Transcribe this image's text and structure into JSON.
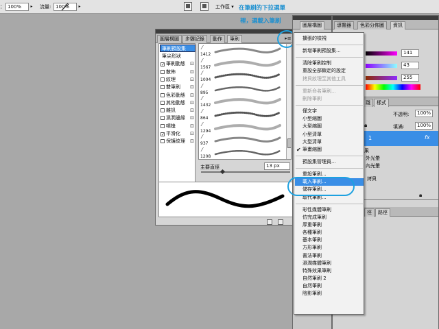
{
  "options_bar": {
    "opacity_label": "：",
    "opacity_value": "100%",
    "flow_label": "流量:",
    "flow_value": "100%",
    "workspace_label": "工作區 ▾"
  },
  "annotation": {
    "line1": "在筆刷的下拉選單",
    "line2": "裡，選載入筆刷"
  },
  "brush_panel": {
    "tabs": [
      "圖層構圖",
      "步驟記錄",
      "動作",
      "筆刷"
    ],
    "presets_header": "筆刷預設集",
    "options": [
      {
        "label": "筆尖形狀",
        "checkbox": false,
        "checked": false,
        "lock": false
      },
      {
        "label": "筆刷動態",
        "checkbox": true,
        "checked": true,
        "lock": true
      },
      {
        "label": "散佈",
        "checkbox": true,
        "checked": false,
        "lock": true
      },
      {
        "label": "紋理",
        "checkbox": true,
        "checked": false,
        "lock": true
      },
      {
        "label": "雙筆刷",
        "checkbox": true,
        "checked": false,
        "lock": true
      },
      {
        "label": "色彩動態",
        "checkbox": true,
        "checked": false,
        "lock": true
      },
      {
        "label": "其他動態",
        "checkbox": true,
        "checked": false,
        "lock": true
      },
      {
        "label": "雜訊",
        "checkbox": true,
        "checked": false,
        "lock": true
      },
      {
        "label": "濕潤邊緣",
        "checkbox": true,
        "checked": false,
        "lock": true
      },
      {
        "label": "噴槍",
        "checkbox": true,
        "checked": false,
        "lock": true
      },
      {
        "label": "平滑化",
        "checkbox": true,
        "checked": true,
        "lock": true
      },
      {
        "label": "保護紋理",
        "checkbox": true,
        "checked": false,
        "lock": true
      }
    ],
    "preset_numbers": [
      "1412",
      "1567",
      "1004",
      "895",
      "1432",
      "864",
      "1294",
      "937",
      "1208"
    ],
    "master_diameter_label": "主要直徑",
    "master_diameter_value": "13 px"
  },
  "menu": {
    "groups": [
      [
        {
          "label": "擴張的檢視",
          "disabled": false,
          "checked": false
        }
      ],
      [
        {
          "label": "新增筆刷預設集...",
          "disabled": false,
          "checked": false
        }
      ],
      [
        {
          "label": "清除筆刷控制",
          "disabled": false,
          "checked": false
        },
        {
          "label": "重設全部鎖定的設定",
          "disabled": false,
          "checked": false
        },
        {
          "label": "拷貝紋理至其他工具",
          "disabled": true,
          "checked": false
        }
      ],
      [
        {
          "label": "重新命名筆刷...",
          "disabled": true,
          "checked": false
        },
        {
          "label": "刪除筆刷",
          "disabled": true,
          "checked": false
        }
      ],
      [
        {
          "label": "僅文字",
          "disabled": false,
          "checked": false
        },
        {
          "label": "小型縮圖",
          "disabled": false,
          "checked": false
        },
        {
          "label": "大型縮圖",
          "disabled": false,
          "checked": false
        },
        {
          "label": "小型清單",
          "disabled": false,
          "checked": false
        },
        {
          "label": "大型清單",
          "disabled": false,
          "checked": false
        },
        {
          "label": "筆畫縮圖",
          "disabled": false,
          "checked": true
        }
      ],
      [
        {
          "label": "預設集管理員...",
          "disabled": false,
          "checked": false
        }
      ],
      [
        {
          "label": "重設筆刷...",
          "disabled": false,
          "checked": false
        },
        {
          "label": "載入筆刷...",
          "disabled": false,
          "checked": false,
          "highlighted": true
        },
        {
          "label": "儲存筆刷...",
          "disabled": false,
          "checked": false
        },
        {
          "label": "取代筆刷...",
          "disabled": false,
          "checked": false
        }
      ],
      [
        {
          "label": "彩性媒體筆刷",
          "disabled": false,
          "checked": false
        },
        {
          "label": "仿完成筆刷",
          "disabled": false,
          "checked": false
        },
        {
          "label": "厚重筆刷",
          "disabled": false,
          "checked": false
        },
        {
          "label": "各種筆刷",
          "disabled": false,
          "checked": false
        },
        {
          "label": "基本筆刷",
          "disabled": false,
          "checked": false
        },
        {
          "label": "方形筆刷",
          "disabled": false,
          "checked": false
        },
        {
          "label": "書法筆刷",
          "disabled": false,
          "checked": false
        },
        {
          "label": "濕潤媒體筆刷",
          "disabled": false,
          "checked": false
        },
        {
          "label": "特殊效果筆刷",
          "disabled": false,
          "checked": false
        },
        {
          "label": "自然筆刷 2",
          "disabled": false,
          "checked": false
        },
        {
          "label": "自然筆刷",
          "disabled": false,
          "checked": false
        },
        {
          "label": "陰影筆刷",
          "disabled": false,
          "checked": false
        }
      ]
    ]
  },
  "right_panels": {
    "nav_tabs": [
      "導覽器",
      "色彩分佈圖",
      "資訊"
    ],
    "color_values": [
      "141",
      "43",
      "255"
    ],
    "layer_tab_partial": "圖層構圖",
    "lower_tabs": [
      "踐",
      "樣式"
    ],
    "opacity_label": "不透明:",
    "opacity_value": "100%",
    "fill_label": "填滿:",
    "fill_value": "100%",
    "layer_name": "1",
    "fx_label": "fx",
    "effect_items": [
      "果",
      "外光暈",
      "內光暈"
    ],
    "copy_label": "拷貝",
    "bottom_tabs": [
      "徑",
      "路徑"
    ]
  },
  "colors": {
    "accent_blue": "#3a8ee6",
    "annotation_blue": "#1a8fd0",
    "circle_blue": "#1da1e0"
  }
}
